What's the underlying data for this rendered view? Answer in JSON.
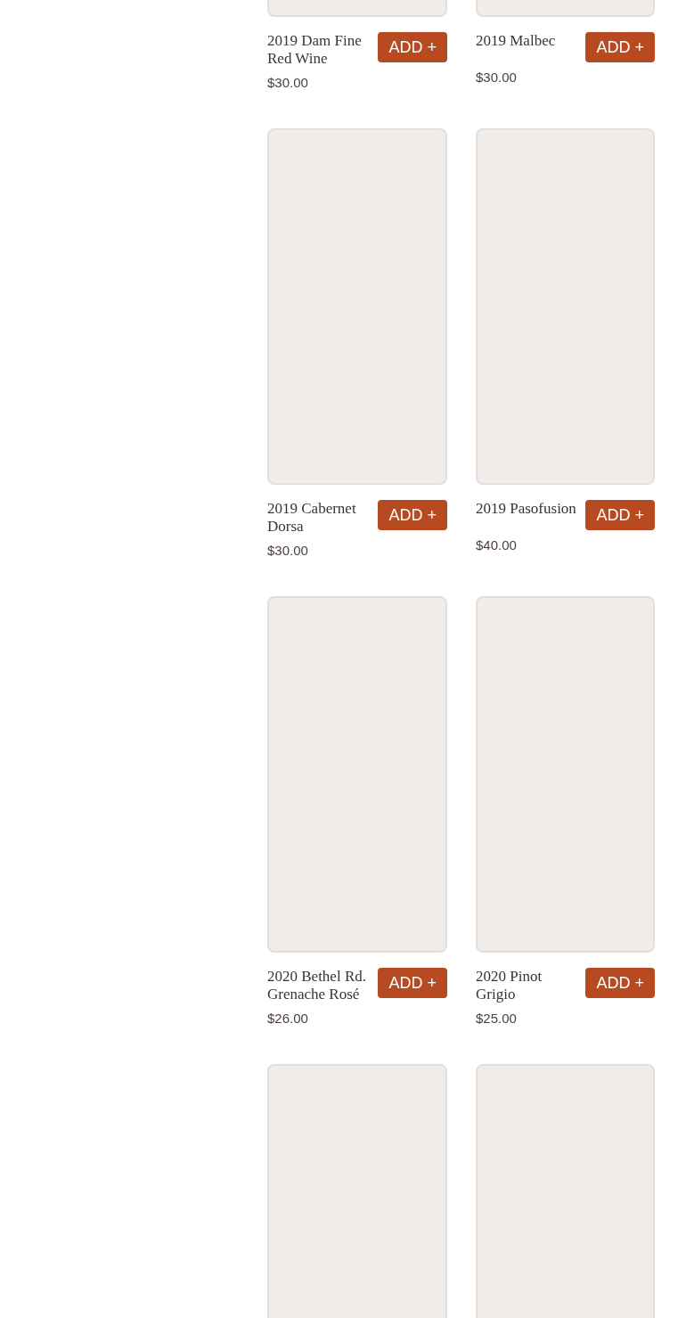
{
  "products": [
    {
      "kind": "product",
      "name": "2019 Dam Fine Red Wine",
      "price": "$30.00",
      "button": "ADD +"
    },
    {
      "kind": "product",
      "name": "2019 Malbec",
      "price": "$30.00",
      "button": "ADD +"
    },
    {
      "kind": "product",
      "name": "2019 Cabernet Dorsa",
      "price": "$30.00",
      "button": "ADD +"
    },
    {
      "kind": "product",
      "name": "2019 Pasofusion",
      "price": "$40.00",
      "button": "ADD +"
    },
    {
      "kind": "product",
      "name": "2020 Bethel Rd. Grenache Rosé",
      "price": "$26.00",
      "button": "ADD +"
    },
    {
      "kind": "product",
      "name": "2020 Pinot Grigio",
      "price": "$25.00",
      "button": "ADD +"
    },
    {
      "kind": "image_only"
    },
    {
      "kind": "image_only"
    }
  ]
}
